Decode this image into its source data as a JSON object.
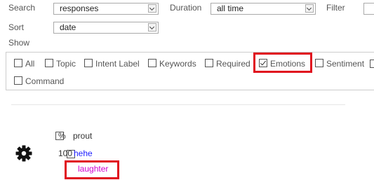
{
  "filters": {
    "search_label": "Search",
    "search_value": "responses",
    "duration_label": "Duration",
    "duration_value": "all time",
    "filter_label": "Filter",
    "sort_label": "Sort",
    "sort_value": "date",
    "show_label": "Show"
  },
  "show_options": [
    {
      "label": "All",
      "checked": false
    },
    {
      "label": "Topic",
      "checked": false
    },
    {
      "label": "Intent Label",
      "checked": false
    },
    {
      "label": "Keywords",
      "checked": false
    },
    {
      "label": "Required",
      "checked": false
    },
    {
      "label": "Emotions",
      "checked": true
    },
    {
      "label": "Sentiment",
      "checked": false
    },
    {
      "label": "Command",
      "checked": false
    }
  ],
  "results": {
    "header_pct": "%",
    "header_text": "prout",
    "rows": [
      {
        "score": "100",
        "text": "hehe",
        "emotion": "laughter"
      }
    ]
  },
  "colors": {
    "highlight": "#e0101e",
    "link": "#1a1aff",
    "emotion": "#d000d0"
  },
  "icons": {
    "settings": "gear-icon",
    "dropdown": "chevron-down-icon"
  }
}
